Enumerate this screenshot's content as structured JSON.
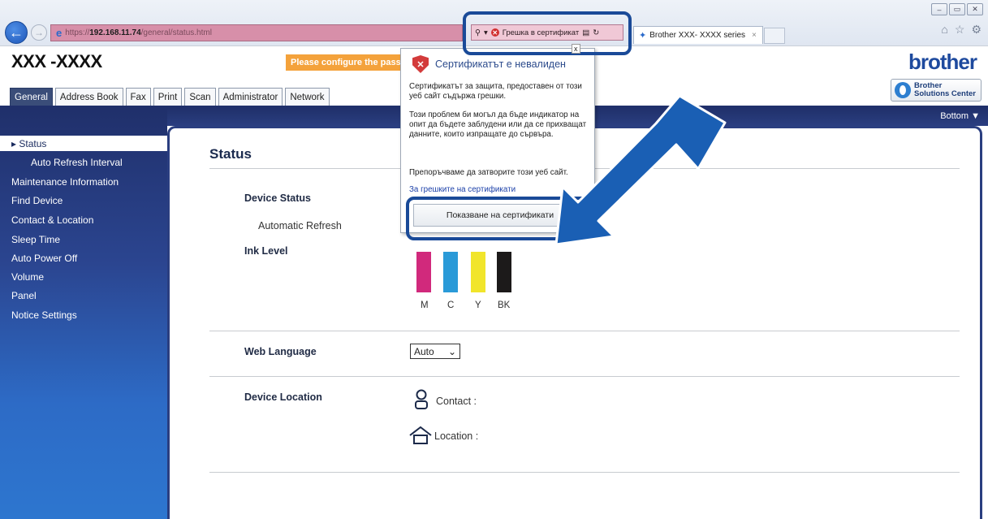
{
  "browser": {
    "url_prefix": "https://",
    "url_host": "192.168.11.74",
    "url_path": "/general/status.html",
    "cert_error_label": "Грешка в сертификат",
    "tab_title": "Brother  XXX- XXXX  series",
    "tab_close": "×",
    "popup_close": "x",
    "window_minimize": "–",
    "window_restore": "▭",
    "window_close": "✕"
  },
  "header": {
    "model": "XXX -XXXX",
    "warning": "Please configure the passw",
    "logo": "brother",
    "solutions_line1": "Brother",
    "solutions_line2": "Solutions Center"
  },
  "tabs": [
    {
      "label": "General"
    },
    {
      "label": "Address Book"
    },
    {
      "label": "Fax"
    },
    {
      "label": "Print"
    },
    {
      "label": "Scan"
    },
    {
      "label": "Administrator"
    },
    {
      "label": "Network"
    }
  ],
  "bottom_link": "Bottom ▼",
  "sidebar": {
    "items": [
      {
        "label": "▸ Status"
      },
      {
        "label": "Auto Refresh Interval"
      },
      {
        "label": "Maintenance Information"
      },
      {
        "label": "Find Device"
      },
      {
        "label": "Contact & Location"
      },
      {
        "label": "Sleep Time"
      },
      {
        "label": "Auto Power Off"
      },
      {
        "label": "Volume"
      },
      {
        "label": "Panel"
      },
      {
        "label": "Notice Settings"
      }
    ]
  },
  "main": {
    "title": "Status",
    "device_status_label": "Device Status",
    "automatic_refresh_label": "Automatic Refresh",
    "ink_level_label": "Ink Level",
    "ink": [
      {
        "name": "M",
        "color": "#d1297c"
      },
      {
        "name": "C",
        "color": "#2a9ad8"
      },
      {
        "name": "Y",
        "color": "#f1e52b"
      },
      {
        "name": "BK",
        "color": "#1c1a1a"
      }
    ],
    "web_language_label": "Web Language",
    "web_language_value": "Auto",
    "device_location_label": "Device Location",
    "contact_label": "Contact :",
    "location_label": "Location :"
  },
  "popup": {
    "title": "Сертификатът е невалиден",
    "para1": "Сертификатът за защита, предоставен от този уеб сайт съдържа грешки.",
    "para2": "Този проблем би могъл да бъде индикатор на опит да бъдете заблудени или да се прихващат данните, които изпращате до сървъра.",
    "para3": "Препоръчваме да затворите този уеб сайт.",
    "link": "За грешките на сертификати",
    "button": "Показване на сертификати"
  },
  "colors": {
    "accent_navy": "#20306b",
    "highlight_blue": "#1a4a98",
    "warning_orange": "#f4a23b",
    "address_error_pink": "#d78fa9"
  }
}
